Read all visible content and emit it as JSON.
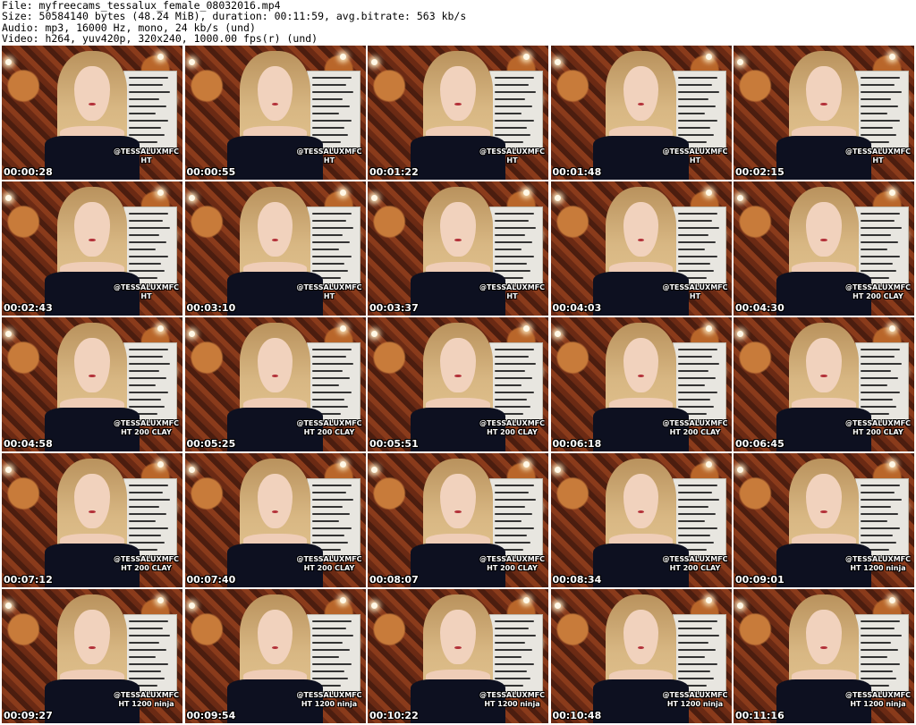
{
  "header": {
    "line1": "File: myfreecams_tessalux_female_08032016.mp4",
    "line2": "Size: 50584140 bytes (48.24 MiB), duration: 00:11:59, avg.bitrate: 563 kb/s",
    "line3": "Audio: mp3, 16000 Hz, mono, 24 kb/s (und)",
    "line4": "Video: h264, yuv420p, 320x240, 1000.00 fps(r) (und)"
  },
  "watermark_handle": "@TESSALUXMFC",
  "thumbnails": [
    {
      "time": "00:00:28",
      "note": "HT"
    },
    {
      "time": "00:00:55",
      "note": "HT"
    },
    {
      "time": "00:01:22",
      "note": "HT"
    },
    {
      "time": "00:01:48",
      "note": "HT"
    },
    {
      "time": "00:02:15",
      "note": "HT"
    },
    {
      "time": "00:02:43",
      "note": "HT"
    },
    {
      "time": "00:03:10",
      "note": "HT"
    },
    {
      "time": "00:03:37",
      "note": "HT"
    },
    {
      "time": "00:04:03",
      "note": "HT"
    },
    {
      "time": "00:04:30",
      "note": "HT 200 CLAY"
    },
    {
      "time": "00:04:58",
      "note": "HT 200 CLAY"
    },
    {
      "time": "00:05:25",
      "note": "HT 200 CLAY"
    },
    {
      "time": "00:05:51",
      "note": "HT 200 CLAY"
    },
    {
      "time": "00:06:18",
      "note": "HT 200 CLAY"
    },
    {
      "time": "00:06:45",
      "note": "HT 200 CLAY"
    },
    {
      "time": "00:07:12",
      "note": "HT 200 CLAY"
    },
    {
      "time": "00:07:40",
      "note": "HT 200 CLAY"
    },
    {
      "time": "00:08:07",
      "note": "HT 200 CLAY"
    },
    {
      "time": "00:08:34",
      "note": "HT 200 CLAY"
    },
    {
      "time": "00:09:01",
      "note": "HT 1200 ninja"
    },
    {
      "time": "00:09:27",
      "note": "HT 1200 ninja"
    },
    {
      "time": "00:09:54",
      "note": "HT 1200 ninja"
    },
    {
      "time": "00:10:22",
      "note": "HT 1200 ninja"
    },
    {
      "time": "00:10:48",
      "note": "HT 1200 ninja"
    },
    {
      "time": "00:11:16",
      "note": "HT 1200 ninja"
    }
  ]
}
